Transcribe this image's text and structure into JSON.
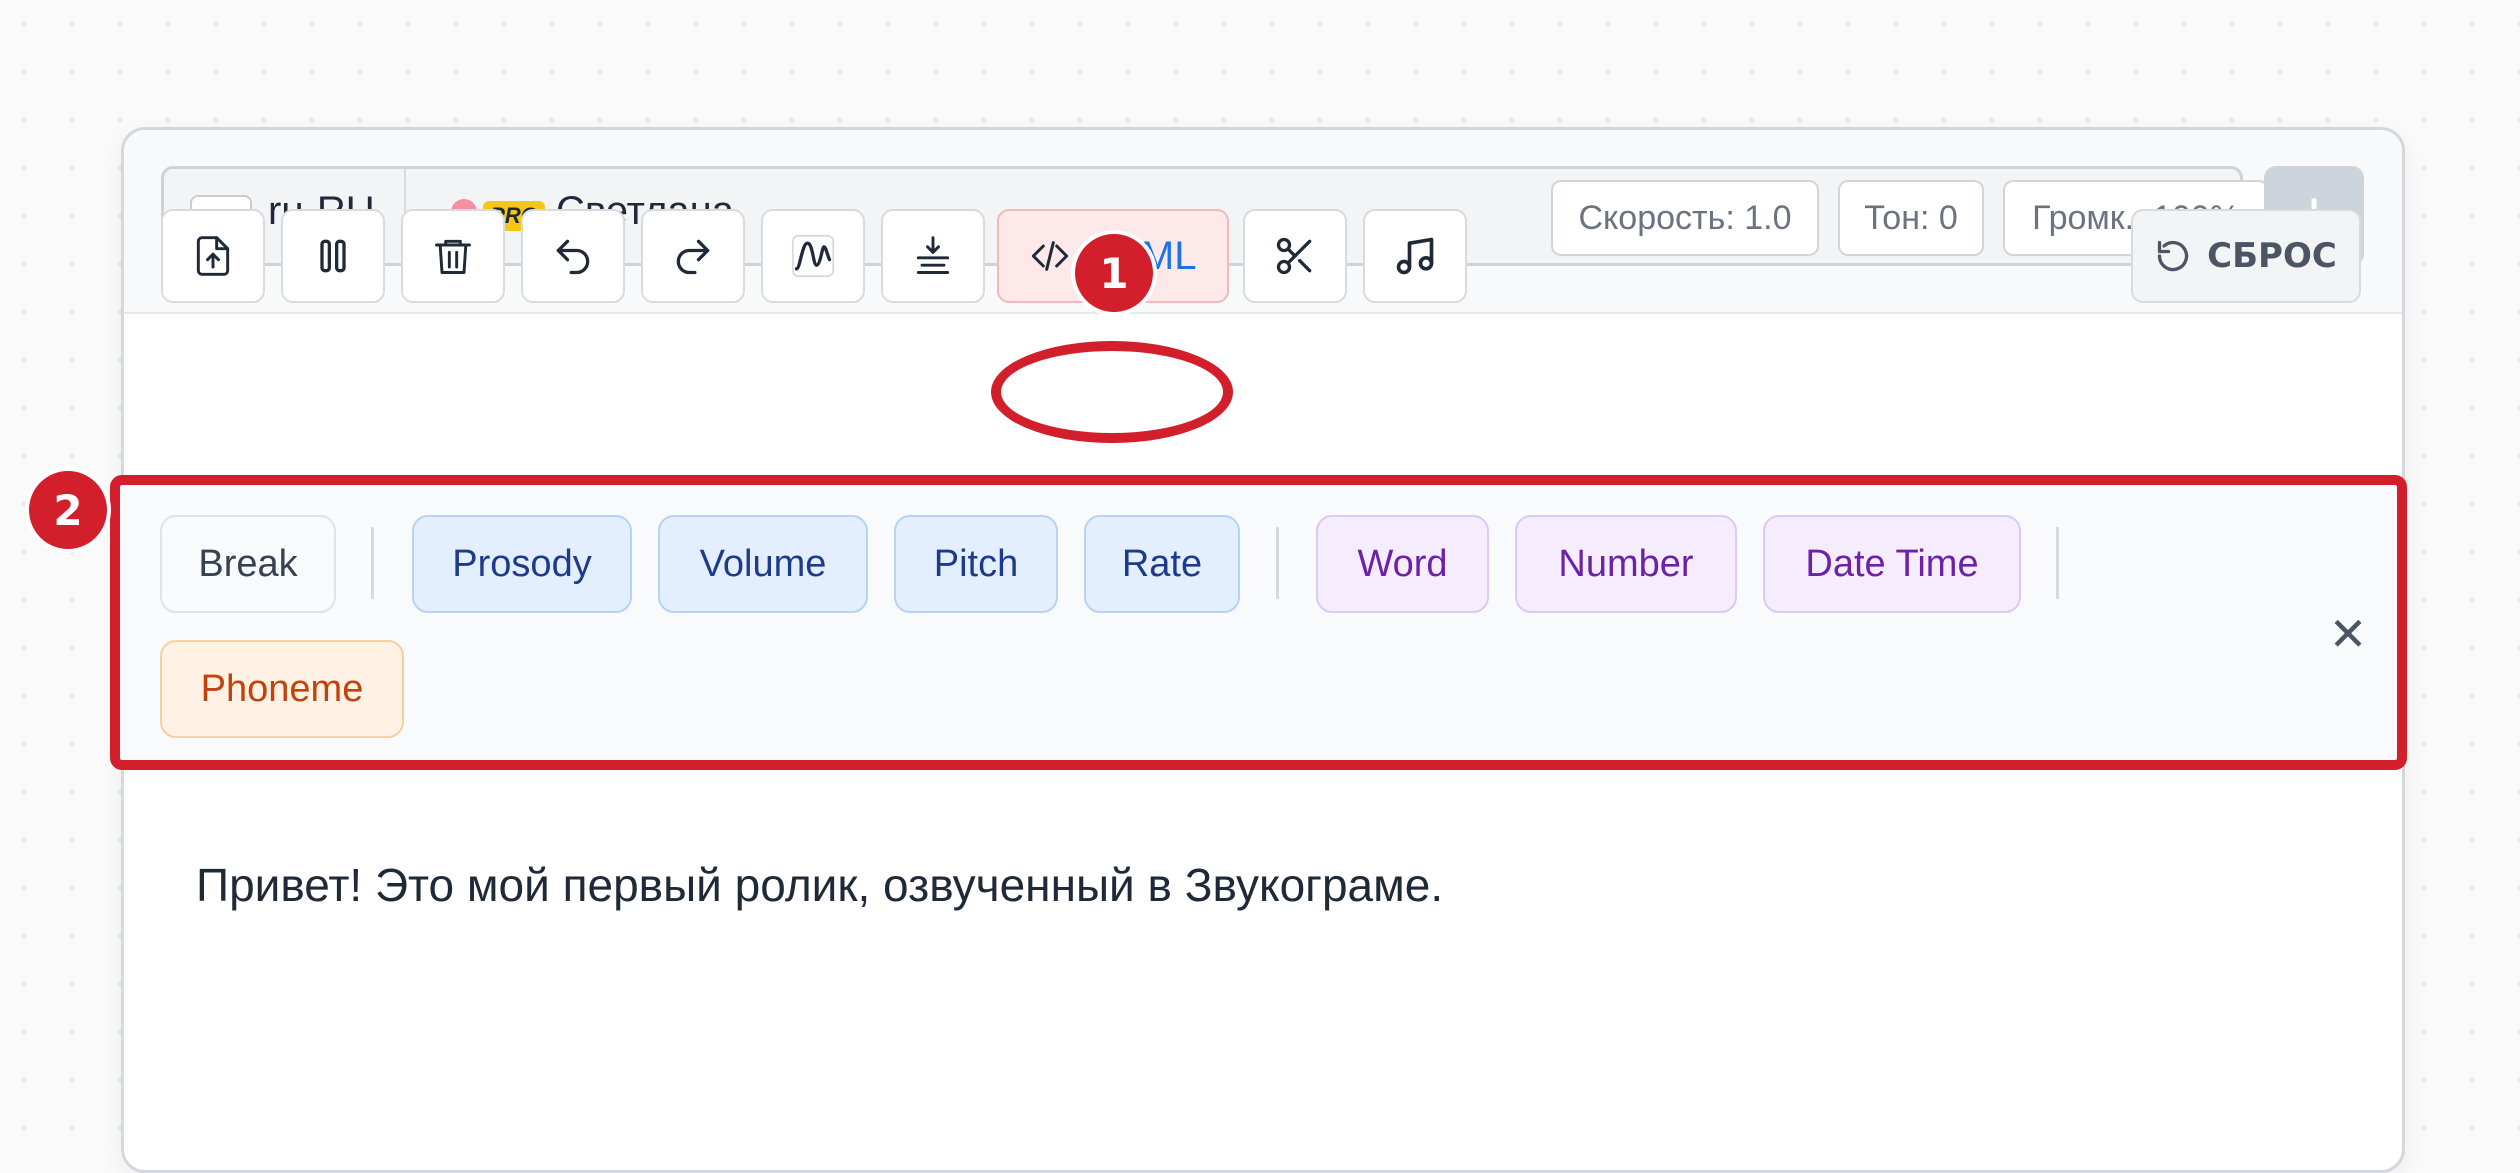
{
  "language": {
    "code": "ru-RU",
    "flag_colors": [
      "#ffffff",
      "#1c57d6",
      "#d41f2e"
    ]
  },
  "voice": {
    "badge": "PRO",
    "name": "Светлана"
  },
  "params": {
    "speed": "Скорость: 1.0",
    "tone": "Тон: 0",
    "volume": "Громк.: 100%"
  },
  "add_button": "+",
  "toolbar": {
    "tools": [
      "upload-icon",
      "pause-icon",
      "trash-icon",
      "undo-icon",
      "redo-icon",
      "waveform-icon",
      "align-download-icon",
      "code-icon",
      "scissors-icon",
      "music-note-icon"
    ],
    "ssml_label": "SSML",
    "reset_label": "СБРОС"
  },
  "ssml_tags": {
    "break": "Break",
    "prosody": "Prosody",
    "volume": "Volume",
    "pitch": "Pitch",
    "rate": "Rate",
    "word": "Word",
    "number": "Number",
    "datetime": "Date Time",
    "phoneme": "Phoneme",
    "close": "✕"
  },
  "editor": {
    "text": "Привет! Это мой первый ролик, озвученный в Звукограме."
  },
  "annotations": {
    "marker1": "1",
    "marker2": "2",
    "color": "#d21f2b"
  }
}
